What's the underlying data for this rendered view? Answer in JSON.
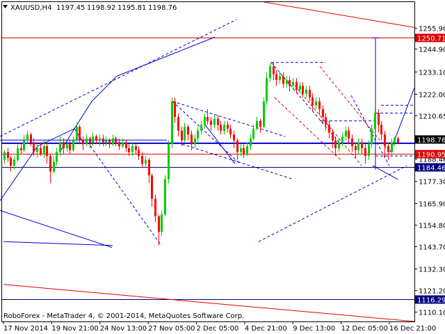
{
  "chart_data": {
    "type": "candlestick",
    "header": {
      "symbol": "XAUUSD,H4",
      "open": "1197.45",
      "high": "1198.92",
      "low": "1195.81",
      "close": "1198.76"
    },
    "copyright": "RoboForex - MetaTrader 4, © 2001-2014, MetaQuotes Software Corp.",
    "ylim": [
      1105,
      1269
    ],
    "y_ticks": [
      "1255.90",
      "1244.90",
      "1233.10",
      "1222.00",
      "1210.65",
      "1198.76",
      "1188.46",
      "1177.30",
      "1165.90",
      "1154.80",
      "1143.70",
      "1132.30",
      "1121.20",
      "1110.10"
    ],
    "x_labels": [
      "17 Nov 2014",
      "19 Nov 21:00",
      "24 Nov 13:00",
      "27 Nov 05:00",
      "2 Dec 05:00",
      "4 Dec 21:00",
      "9 Dec 13:00",
      "12 Dec 05:00",
      "16 Dec 21:00"
    ],
    "levels": [
      {
        "label": "1250.71",
        "value": 1250.71,
        "color": "#dd0000"
      },
      {
        "label": "1198.76",
        "value": 1198.76,
        "color": "#000000"
      },
      {
        "label": "1190.95",
        "value": 1190.95,
        "color": "#dd0000"
      },
      {
        "label": "1184.46",
        "value": 1184.46,
        "color": "#000080"
      },
      {
        "label": "1116.29",
        "value": 1116.29,
        "color": "#000080"
      }
    ],
    "support_line_value": 1196.5,
    "colors": {
      "bull": "#00cc00",
      "bear": "#ff0000",
      "annotation": "#0000cc",
      "channel": "#dd0000",
      "axis": "#000000"
    },
    "candles": [
      [
        1188,
        1192,
        1186,
        1193
      ],
      [
        1192,
        1189,
        1187,
        1194
      ],
      [
        1189,
        1185,
        1182,
        1190
      ],
      [
        1185,
        1188,
        1183,
        1190
      ],
      [
        1188,
        1194,
        1187,
        1196
      ],
      [
        1194,
        1193,
        1191,
        1197
      ],
      [
        1193,
        1198,
        1192,
        1201
      ],
      [
        1198,
        1201,
        1196,
        1203
      ],
      [
        1201,
        1197,
        1195,
        1202
      ],
      [
        1197,
        1192,
        1190,
        1199
      ],
      [
        1192,
        1194,
        1189,
        1196
      ],
      [
        1194,
        1191,
        1190,
        1197
      ],
      [
        1191,
        1195,
        1189,
        1198
      ],
      [
        1195,
        1190,
        1186,
        1197
      ],
      [
        1190,
        1182,
        1176,
        1191
      ],
      [
        1182,
        1187,
        1181,
        1190
      ],
      [
        1187,
        1192,
        1185,
        1194
      ],
      [
        1192,
        1197,
        1190,
        1200
      ],
      [
        1197,
        1194,
        1191,
        1199
      ],
      [
        1194,
        1196,
        1192,
        1198
      ],
      [
        1196,
        1193,
        1191,
        1198
      ],
      [
        1193,
        1198,
        1192,
        1200
      ],
      [
        1198,
        1205,
        1197,
        1207
      ],
      [
        1205,
        1198,
        1196,
        1206
      ],
      [
        1198,
        1196,
        1193,
        1200
      ],
      [
        1196,
        1199,
        1195,
        1201
      ],
      [
        1199,
        1197,
        1194,
        1200
      ],
      [
        1197,
        1200,
        1195,
        1202
      ],
      [
        1200,
        1198,
        1196,
        1201
      ],
      [
        1198,
        1199,
        1195,
        1201
      ],
      [
        1199,
        1197,
        1195,
        1201
      ],
      [
        1197,
        1198,
        1195,
        1200
      ],
      [
        1198,
        1196,
        1194,
        1199
      ],
      [
        1196,
        1199,
        1195,
        1201
      ],
      [
        1199,
        1197,
        1195,
        1200
      ],
      [
        1197,
        1195,
        1193,
        1199
      ],
      [
        1195,
        1197,
        1194,
        1199
      ],
      [
        1197,
        1194,
        1192,
        1198
      ],
      [
        1194,
        1192,
        1190,
        1196
      ],
      [
        1192,
        1195,
        1190,
        1197
      ],
      [
        1195,
        1193,
        1191,
        1196
      ],
      [
        1193,
        1190,
        1188,
        1195
      ],
      [
        1190,
        1186,
        1184,
        1192
      ],
      [
        1186,
        1188,
        1184,
        1190
      ],
      [
        1188,
        1180,
        1176,
        1189
      ],
      [
        1180,
        1168,
        1164,
        1181
      ],
      [
        1168,
        1159,
        1156,
        1170
      ],
      [
        1159,
        1151,
        1144,
        1160
      ],
      [
        1151,
        1160,
        1149,
        1162
      ],
      [
        1160,
        1178,
        1159,
        1180
      ],
      [
        1178,
        1196,
        1176,
        1198
      ],
      [
        1196,
        1218,
        1194,
        1220
      ],
      [
        1218,
        1210,
        1207,
        1220
      ],
      [
        1210,
        1203,
        1200,
        1212
      ],
      [
        1203,
        1198,
        1195,
        1205
      ],
      [
        1198,
        1205,
        1197,
        1207
      ],
      [
        1205,
        1201,
        1198,
        1206
      ],
      [
        1201,
        1196,
        1193,
        1203
      ],
      [
        1196,
        1199,
        1194,
        1201
      ],
      [
        1199,
        1203,
        1197,
        1205
      ],
      [
        1203,
        1206,
        1201,
        1208
      ],
      [
        1206,
        1210,
        1204,
        1212
      ],
      [
        1210,
        1208,
        1206,
        1214
      ],
      [
        1208,
        1206,
        1203,
        1210
      ],
      [
        1206,
        1209,
        1204,
        1211
      ],
      [
        1209,
        1206,
        1203,
        1211
      ],
      [
        1206,
        1203,
        1201,
        1208
      ],
      [
        1203,
        1206,
        1201,
        1208
      ],
      [
        1206,
        1204,
        1202,
        1208
      ],
      [
        1204,
        1201,
        1199,
        1206
      ],
      [
        1201,
        1198,
        1194,
        1203
      ],
      [
        1198,
        1192,
        1188,
        1199
      ],
      [
        1192,
        1194,
        1190,
        1196
      ],
      [
        1194,
        1191,
        1189,
        1196
      ],
      [
        1191,
        1195,
        1190,
        1197
      ],
      [
        1195,
        1199,
        1193,
        1201
      ],
      [
        1199,
        1204,
        1198,
        1206
      ],
      [
        1204,
        1208,
        1203,
        1210
      ],
      [
        1208,
        1205,
        1202,
        1209
      ],
      [
        1205,
        1218,
        1204,
        1220
      ],
      [
        1218,
        1230,
        1216,
        1233
      ],
      [
        1230,
        1236,
        1228,
        1238
      ],
      [
        1236,
        1232,
        1229,
        1238
      ],
      [
        1232,
        1229,
        1226,
        1234
      ],
      [
        1229,
        1231,
        1227,
        1233
      ],
      [
        1231,
        1227,
        1225,
        1233
      ],
      [
        1227,
        1229,
        1225,
        1231
      ],
      [
        1229,
        1226,
        1223,
        1231
      ],
      [
        1226,
        1228,
        1224,
        1230
      ],
      [
        1228,
        1224,
        1222,
        1230
      ],
      [
        1224,
        1226,
        1222,
        1228
      ],
      [
        1226,
        1222,
        1220,
        1228
      ],
      [
        1222,
        1224,
        1220,
        1226
      ],
      [
        1224,
        1220,
        1218,
        1226
      ],
      [
        1220,
        1216,
        1213,
        1222
      ],
      [
        1216,
        1218,
        1214,
        1220
      ],
      [
        1218,
        1214,
        1211,
        1220
      ],
      [
        1214,
        1210,
        1207,
        1216
      ],
      [
        1210,
        1206,
        1203,
        1212
      ],
      [
        1206,
        1202,
        1199,
        1208
      ],
      [
        1202,
        1198,
        1194,
        1204
      ],
      [
        1198,
        1194,
        1190,
        1200
      ],
      [
        1194,
        1197,
        1192,
        1199
      ],
      [
        1197,
        1200,
        1195,
        1202
      ],
      [
        1200,
        1203,
        1198,
        1205
      ],
      [
        1203,
        1199,
        1196,
        1205
      ],
      [
        1199,
        1195,
        1192,
        1201
      ],
      [
        1195,
        1193,
        1189,
        1197
      ],
      [
        1193,
        1197,
        1191,
        1199
      ],
      [
        1197,
        1194,
        1191,
        1199
      ],
      [
        1194,
        1190,
        1186,
        1196
      ],
      [
        1190,
        1196,
        1188,
        1198
      ],
      [
        1196,
        1204,
        1194,
        1206
      ],
      [
        1204,
        1212,
        1202,
        1214
      ],
      [
        1212,
        1206,
        1202,
        1214
      ],
      [
        1206,
        1201,
        1198,
        1208
      ],
      [
        1201,
        1195,
        1189,
        1203
      ],
      [
        1195,
        1192,
        1188,
        1197
      ],
      [
        1192,
        1197,
        1190,
        1199
      ],
      [
        1197,
        1199,
        1195,
        1200
      ],
      [
        1199,
        1197,
        1196,
        1200
      ]
    ],
    "annotations": [
      {
        "kind": "solid",
        "color": "annotation",
        "points": [
          [
            0,
            1167
          ],
          [
            54,
            1195
          ],
          [
            107,
            1204
          ],
          [
            132,
            1218
          ],
          [
            168,
            1231
          ],
          [
            309,
            1251
          ]
        ]
      },
      {
        "kind": "solid",
        "color": "annotation",
        "points": [
          [
            0,
            1162
          ],
          [
            161,
            1143
          ]
        ]
      },
      {
        "kind": "solid",
        "color": "annotation",
        "points": [
          [
            5,
            1146
          ],
          [
            162,
            1144
          ]
        ]
      },
      {
        "kind": "solid",
        "color": "annotation",
        "points": [
          [
            0,
            1198.2
          ],
          [
            240,
            1198.2
          ]
        ]
      },
      {
        "kind": "solid",
        "color": "annotation",
        "points": [
          [
            88,
            1193
          ],
          [
            107,
            1204
          ],
          [
            120,
            1197
          ]
        ]
      },
      {
        "kind": "solid",
        "color": "annotation",
        "points": [
          [
            295,
            1206
          ],
          [
            338,
            1186
          ]
        ]
      },
      {
        "kind": "solid",
        "color": "annotation",
        "points": [
          [
            536,
            1185
          ],
          [
            572,
            1178
          ]
        ]
      },
      {
        "kind": "solid",
        "color": "annotation",
        "points": [
          [
            540,
            1183
          ],
          [
            540,
            1250.71
          ]
        ]
      },
      {
        "kind": "solid",
        "color": "annotation",
        "points": [
          [
            561,
            1192
          ],
          [
            596,
            1225
          ]
        ]
      },
      {
        "kind": "dashed",
        "color": "annotation",
        "points": [
          [
            0,
            1200
          ],
          [
            340,
            1260
          ]
        ]
      },
      {
        "kind": "dashed",
        "color": "annotation",
        "points": [
          [
            130,
            1195
          ],
          [
            232,
            1144
          ]
        ]
      },
      {
        "kind": "dashed",
        "color": "annotation",
        "points": [
          [
            248,
            1218
          ],
          [
            410,
            1200
          ]
        ]
      },
      {
        "kind": "dashed",
        "color": "annotation",
        "points": [
          [
            248,
            1218
          ],
          [
            345,
            1186
          ]
        ]
      },
      {
        "kind": "dashed",
        "color": "annotation",
        "points": [
          [
            262,
            1196
          ],
          [
            422,
            1178
          ]
        ]
      },
      {
        "kind": "dashed",
        "color": "annotation",
        "points": [
          [
            390,
            1238
          ],
          [
            468,
            1238
          ]
        ]
      },
      {
        "kind": "dashed",
        "color": "annotation",
        "points": [
          [
            390,
            1238
          ],
          [
            490,
            1196
          ]
        ]
      },
      {
        "kind": "dashed",
        "color": "annotation",
        "points": [
          [
            372,
            1146
          ],
          [
            585,
            1185
          ]
        ]
      },
      {
        "kind": "dashed",
        "color": "annotation",
        "points": [
          [
            460,
            1208
          ],
          [
            540,
            1208
          ]
        ]
      },
      {
        "kind": "dashed",
        "color": "annotation",
        "points": [
          [
            505,
            1221
          ],
          [
            560,
            1185
          ]
        ]
      },
      {
        "kind": "dashed",
        "color": "annotation",
        "points": [
          [
            540,
            1212
          ],
          [
            596,
            1212
          ]
        ]
      },
      {
        "kind": "dashed",
        "color": "annotation",
        "points": [
          [
            540,
            1190
          ],
          [
            596,
            1190
          ]
        ]
      },
      {
        "kind": "dashed",
        "color": "annotation",
        "points": [
          [
            548,
            1216
          ],
          [
            596,
            1216
          ]
        ]
      },
      {
        "kind": "dashed",
        "color": "annotation",
        "points": [
          [
            535,
            1250.71
          ],
          [
            545,
            1250.71
          ]
        ]
      },
      {
        "kind": "solid",
        "color": "channel",
        "points": [
          [
            380,
            1269
          ],
          [
            596,
            1256
          ]
        ]
      },
      {
        "kind": "solid",
        "color": "channel",
        "points": [
          [
            5,
            1124
          ],
          [
            596,
            1105
          ]
        ]
      },
      {
        "kind": "dashed",
        "color": "channel",
        "points": [
          [
            420,
            1228
          ],
          [
            520,
            1185
          ]
        ]
      },
      {
        "kind": "dashed",
        "color": "channel",
        "points": [
          [
            460,
            1236
          ],
          [
            560,
            1192
          ]
        ]
      },
      {
        "kind": "dashed",
        "color": "channel",
        "points": [
          [
            395,
            1220
          ],
          [
            490,
            1188
          ]
        ]
      }
    ]
  }
}
